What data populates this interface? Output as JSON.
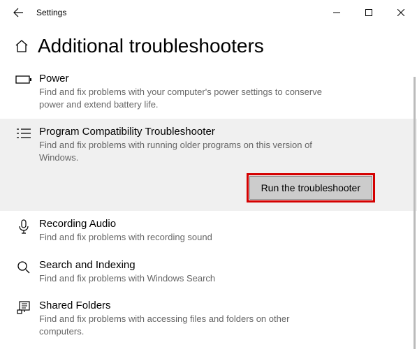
{
  "app": {
    "title": "Settings"
  },
  "page": {
    "title": "Additional troubleshooters"
  },
  "items": [
    {
      "icon": "battery-icon",
      "title": "Power",
      "desc": "Find and fix problems with your computer's power settings to conserve power and extend battery life."
    },
    {
      "icon": "checklist-icon",
      "title": "Program Compatibility Troubleshooter",
      "desc": "Find and fix problems with running older programs on this version of Windows.",
      "selected": true,
      "action": "Run the troubleshooter"
    },
    {
      "icon": "mic-icon",
      "title": "Recording Audio",
      "desc": "Find and fix problems with recording sound"
    },
    {
      "icon": "search-icon",
      "title": "Search and Indexing",
      "desc": "Find and fix problems with Windows Search"
    },
    {
      "icon": "folder-icon",
      "title": "Shared Folders",
      "desc": "Find and fix problems with accessing files and folders on other computers."
    }
  ]
}
